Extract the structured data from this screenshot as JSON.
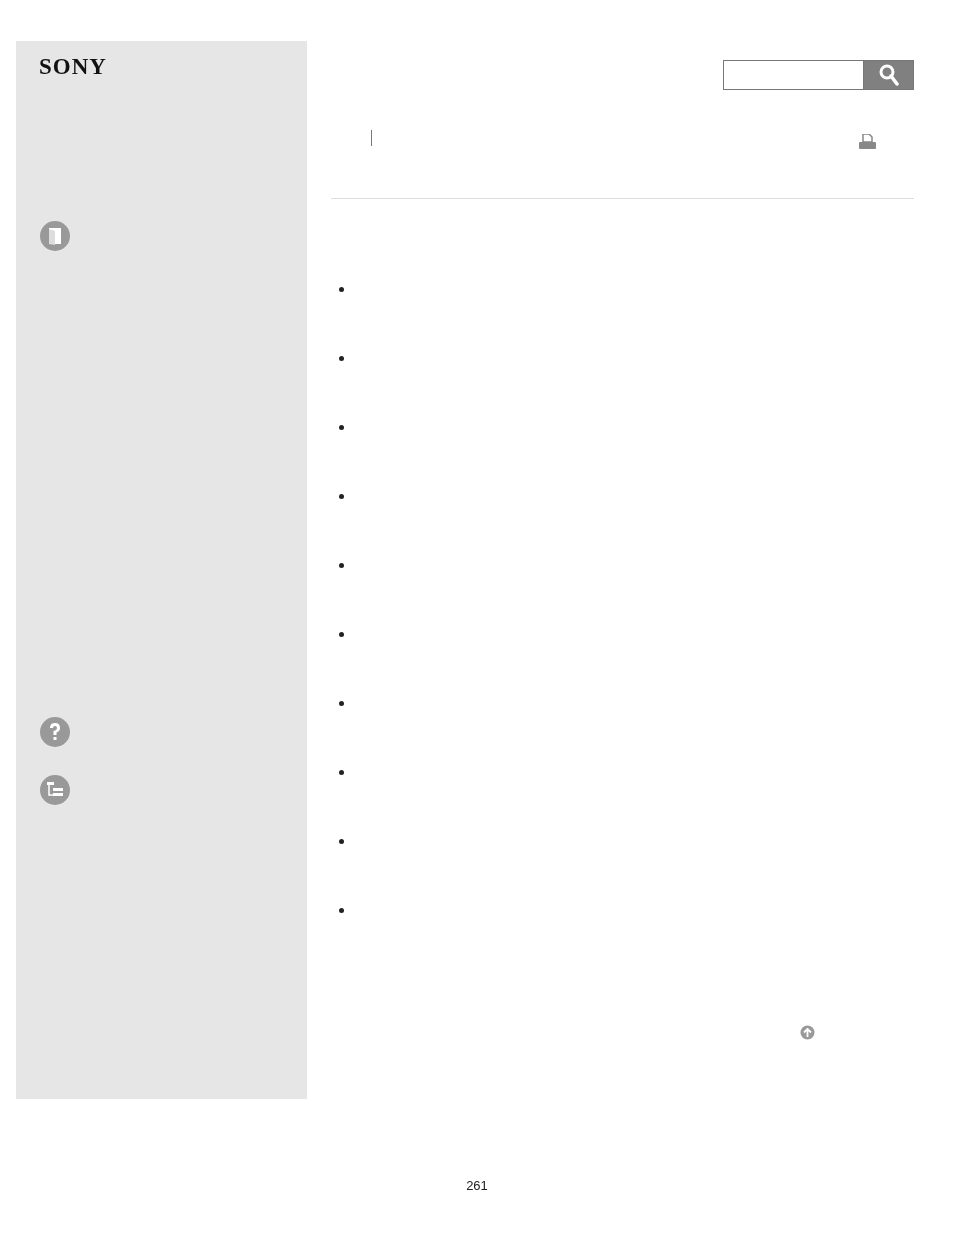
{
  "logo": {
    "text": "SONY"
  },
  "search": {
    "button": {
      "kind": "search"
    }
  },
  "sidebar": {
    "icons": [
      {
        "kind": "book"
      },
      {
        "kind": "help"
      },
      {
        "kind": "tree"
      }
    ]
  },
  "list_items": [
    {
      "kind": "bullet"
    },
    {
      "kind": "bullet"
    },
    {
      "kind": "bullet"
    },
    {
      "kind": "bullet"
    },
    {
      "kind": "bullet"
    },
    {
      "kind": "bullet"
    },
    {
      "kind": "bullet"
    },
    {
      "kind": "bullet"
    },
    {
      "kind": "bullet"
    },
    {
      "kind": "bullet"
    }
  ],
  "page_number": "261"
}
